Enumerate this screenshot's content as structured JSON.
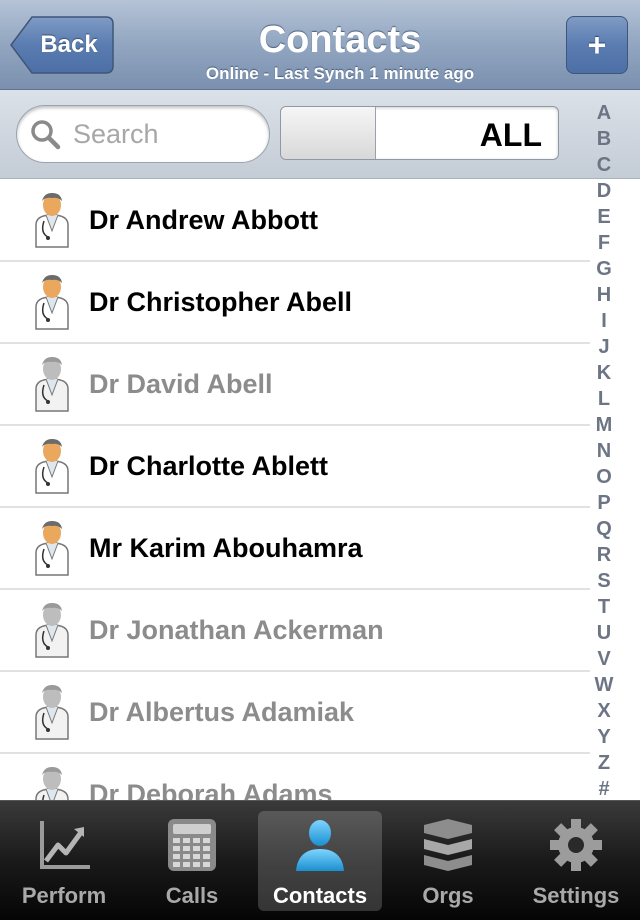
{
  "navbar": {
    "back_label": "Back",
    "title": "Contacts",
    "subtitle": "Online - Last Synch 1 minute ago",
    "add_label": "+"
  },
  "search": {
    "placeholder": "Search",
    "filter_label": "ALL"
  },
  "contacts": [
    {
      "name": "Dr Andrew Abbott",
      "active": true
    },
    {
      "name": "Dr Christopher Abell",
      "active": true
    },
    {
      "name": "Dr David Abell",
      "active": false
    },
    {
      "name": "Dr Charlotte Ablett",
      "active": true
    },
    {
      "name": "Mr Karim Abouhamra",
      "active": true
    },
    {
      "name": "Dr Jonathan Ackerman",
      "active": false
    },
    {
      "name": "Dr Albertus Adamiak",
      "active": false
    },
    {
      "name": "Dr Deborah Adams",
      "active": false
    }
  ],
  "index_letters": [
    "A",
    "B",
    "C",
    "D",
    "E",
    "F",
    "G",
    "H",
    "I",
    "J",
    "K",
    "L",
    "M",
    "N",
    "O",
    "P",
    "Q",
    "R",
    "S",
    "T",
    "U",
    "V",
    "W",
    "X",
    "Y",
    "Z",
    "#"
  ],
  "tabs": [
    {
      "label": "Perform",
      "icon": "chart-icon",
      "active": false
    },
    {
      "label": "Calls",
      "icon": "calculator-icon",
      "active": false
    },
    {
      "label": "Contacts",
      "icon": "person-icon",
      "active": true
    },
    {
      "label": "Orgs",
      "icon": "database-icon",
      "active": false
    },
    {
      "label": "Settings",
      "icon": "gear-icon",
      "active": false
    }
  ],
  "colors": {
    "navbar": "#92a6c1",
    "active_name": "#000000",
    "inactive_name": "#8c8c8c",
    "index_letter": "#6d7585",
    "tab_active_icon": "#2fa6de"
  }
}
